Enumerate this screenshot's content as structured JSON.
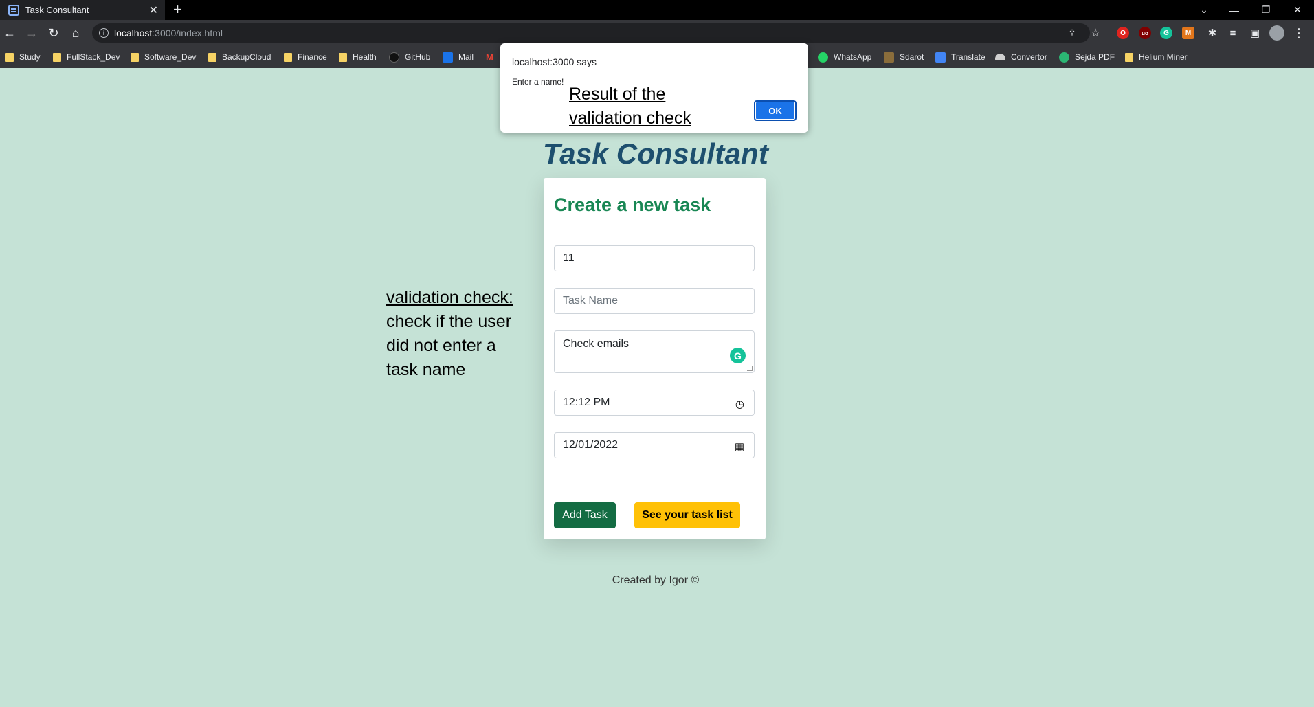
{
  "browser": {
    "tab_title": "Task Consultant",
    "new_tab": "+",
    "url_host": "localhost",
    "url_path": ":3000/index.html",
    "bookmarks": [
      {
        "label": "Study",
        "icon": "folder-icon"
      },
      {
        "label": "FullStack_Dev",
        "icon": "folder-icon"
      },
      {
        "label": "Software_Dev",
        "icon": "folder-icon"
      },
      {
        "label": "BackupCloud",
        "icon": "folder-icon"
      },
      {
        "label": "Finance",
        "icon": "folder-icon"
      },
      {
        "label": "Health",
        "icon": "folder-icon"
      },
      {
        "label": "GitHub",
        "icon": "github-icon"
      },
      {
        "label": "Mail",
        "icon": "mail-icon"
      },
      {
        "label": "WhatsApp",
        "icon": "whatsapp-icon"
      },
      {
        "label": "Sdarot",
        "icon": "sdarot-icon"
      },
      {
        "label": "Translate",
        "icon": "translate-icon"
      },
      {
        "label": "Convertor",
        "icon": "cloud-icon"
      },
      {
        "label": "Sejda PDF",
        "icon": "sejda-icon"
      },
      {
        "label": "Helium Miner",
        "icon": "folder-icon"
      }
    ]
  },
  "alert": {
    "origin": "localhost:3000 says",
    "message": "Enter a name!",
    "ok_label": "OK",
    "annotation": "Result of the validation check"
  },
  "page": {
    "title": "Task Consultant",
    "card_title": "Create a new task",
    "fields": {
      "task_id_value": "11",
      "task_name_placeholder": "Task Name",
      "description_value": "Check emails",
      "time_value": "12:12  PM",
      "date_value": "12/01/2022"
    },
    "add_button": "Add Task",
    "list_button": "See your task list",
    "footer": "Created by Igor ©"
  },
  "annotation": {
    "heading": "validation check:",
    "body": "check if the user did not enter a task name"
  },
  "colors": {
    "page_bg": "#c5e2d6",
    "title": "#1d4f6e",
    "card_title": "#198754",
    "add_button": "#146c43",
    "list_button": "#ffc107",
    "alert_ok": "#1a73e8"
  }
}
